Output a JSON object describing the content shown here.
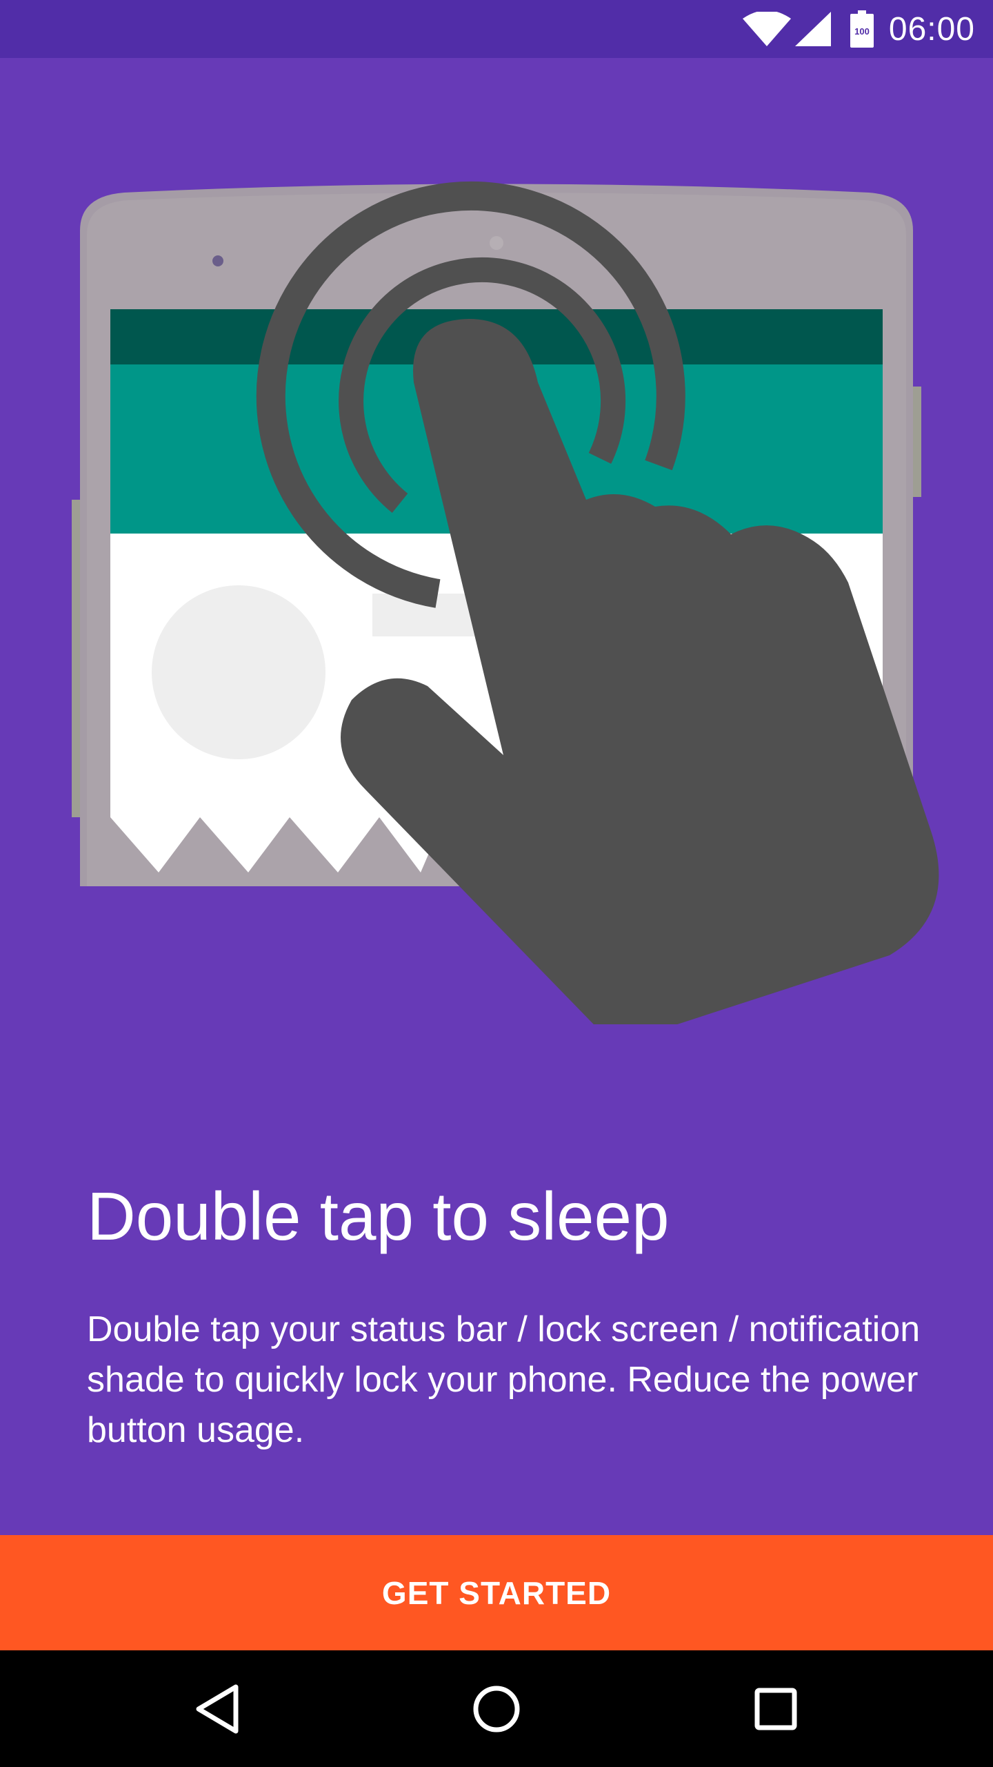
{
  "status_bar": {
    "time": "06:00",
    "battery_level": "100",
    "icons": [
      "wifi-icon",
      "signal-icon",
      "battery-icon"
    ],
    "background_color": "#512DA8"
  },
  "onboarding": {
    "illustration": "double-tap-hand-on-phone",
    "title": "Double tap to sleep",
    "description": "Double tap your status bar / lock screen / notification shade to quickly lock your phone. Reduce the power button usage.",
    "background_color": "#673AB7"
  },
  "action": {
    "label": "GET STARTED",
    "color": "#FF5722"
  },
  "navigation_bar": {
    "buttons": [
      "back-icon",
      "home-icon",
      "recents-icon"
    ]
  }
}
